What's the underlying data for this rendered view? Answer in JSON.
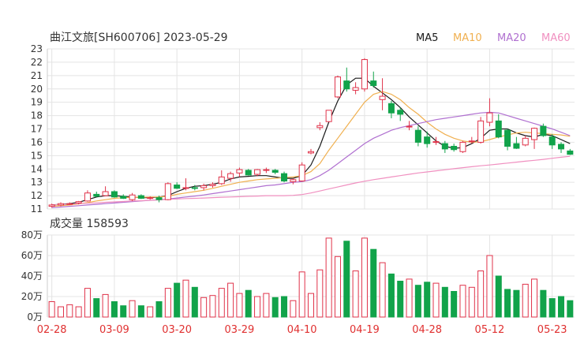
{
  "header": {
    "title": "曲江文旅[SH600706] 2023-05-29",
    "legend": [
      {
        "label": "MA5",
        "color": "#1a1a1a"
      },
      {
        "label": "MA10",
        "color": "#f0b050"
      },
      {
        "label": "MA20",
        "color": "#b070d0"
      },
      {
        "label": "MA60",
        "color": "#f090c0"
      }
    ]
  },
  "volume_panel": {
    "title": "成交量 158593"
  },
  "colors": {
    "up": "#e0334a",
    "down": "#11a34a",
    "grid": "#e4e4e4",
    "text": "#333333",
    "xtick": "#e03030"
  },
  "chart_data": [
    {
      "type": "candlestick",
      "title": "曲江文旅[SH600706] 2023-05-29",
      "ylim": [
        11,
        23
      ],
      "yticks": [
        11,
        12,
        13,
        14,
        15,
        16,
        17,
        18,
        19,
        20,
        21,
        22,
        23
      ],
      "grid": true,
      "legend_position": "top-right",
      "xticks": [
        "02-28",
        "03-09",
        "03-20",
        "03-29",
        "04-10",
        "04-19",
        "04-28",
        "05-12",
        "05-23"
      ],
      "xtick_index": [
        0,
        7,
        14,
        21,
        28,
        35,
        42,
        49,
        56
      ],
      "series": [
        {
          "name": "MA5",
          "values": [
            11.3,
            11.35,
            11.4,
            11.5,
            11.7,
            11.9,
            12.0,
            12.0,
            11.95,
            11.9,
            11.85,
            11.85,
            11.9,
            12.0,
            12.3,
            12.55,
            12.7,
            12.75,
            12.85,
            13.0,
            13.25,
            13.4,
            13.45,
            13.5,
            13.5,
            13.4,
            13.3,
            13.3,
            13.5,
            14.3,
            15.7,
            17.5,
            19.1,
            20.3,
            20.8,
            20.8,
            20.2,
            19.7,
            19.2,
            18.6,
            17.9,
            17.3,
            16.7,
            16.1,
            15.7,
            15.55,
            15.6,
            15.9,
            16.3,
            16.9,
            17.0,
            17.0,
            16.7,
            16.5,
            16.4,
            16.6,
            16.5,
            16.2,
            15.9
          ]
        },
        {
          "name": "MA10",
          "values": [
            11.2,
            11.25,
            11.3,
            11.38,
            11.48,
            11.6,
            11.7,
            11.8,
            11.85,
            11.88,
            11.88,
            11.9,
            11.9,
            11.95,
            12.1,
            12.2,
            12.3,
            12.4,
            12.55,
            12.7,
            12.85,
            13.0,
            13.1,
            13.2,
            13.25,
            13.3,
            13.35,
            13.4,
            13.5,
            13.8,
            14.4,
            15.4,
            16.3,
            17.2,
            18.1,
            19.0,
            19.6,
            19.8,
            19.6,
            19.2,
            18.6,
            18.1,
            17.5,
            17.0,
            16.6,
            16.3,
            16.1,
            16.0,
            16.05,
            16.2,
            16.4,
            16.55,
            16.7,
            16.75,
            16.7,
            16.65,
            16.6,
            16.55,
            16.45
          ]
        },
        {
          "name": "MA20",
          "values": [
            11.1,
            11.15,
            11.2,
            11.25,
            11.3,
            11.35,
            11.4,
            11.45,
            11.5,
            11.55,
            11.6,
            11.65,
            11.7,
            11.75,
            11.82,
            11.9,
            11.97,
            12.05,
            12.15,
            12.25,
            12.35,
            12.45,
            12.55,
            12.65,
            12.75,
            12.8,
            12.9,
            13.0,
            13.05,
            13.2,
            13.5,
            13.9,
            14.4,
            14.9,
            15.4,
            15.9,
            16.3,
            16.6,
            16.9,
            17.1,
            17.25,
            17.4,
            17.55,
            17.7,
            17.8,
            17.9,
            18.0,
            18.1,
            18.2,
            18.25,
            18.2,
            18.0,
            17.8,
            17.6,
            17.4,
            17.2,
            17.0,
            16.75,
            16.5
          ]
        },
        {
          "name": "MA60",
          "values": [
            11.3,
            11.33,
            11.36,
            11.4,
            11.43,
            11.46,
            11.5,
            11.53,
            11.56,
            11.6,
            11.62,
            11.65,
            11.68,
            11.72,
            11.75,
            11.78,
            11.8,
            11.82,
            11.85,
            11.88,
            11.9,
            11.92,
            11.95,
            11.97,
            12.0,
            12.0,
            12.0,
            12.02,
            12.08,
            12.2,
            12.35,
            12.5,
            12.65,
            12.8,
            12.95,
            13.08,
            13.2,
            13.3,
            13.4,
            13.5,
            13.6,
            13.7,
            13.78,
            13.86,
            13.94,
            14.02,
            14.1,
            14.17,
            14.24,
            14.3,
            14.37,
            14.44,
            14.51,
            14.58,
            14.65,
            14.72,
            14.8,
            14.88,
            14.95
          ]
        }
      ],
      "ohlc": [
        [
          11.2,
          11.4,
          11.1,
          11.3
        ],
        [
          11.3,
          11.5,
          11.2,
          11.4
        ],
        [
          11.4,
          11.5,
          11.3,
          11.4
        ],
        [
          11.45,
          11.6,
          11.35,
          11.55
        ],
        [
          11.6,
          12.4,
          11.55,
          12.2
        ],
        [
          12.1,
          12.3,
          11.9,
          11.95
        ],
        [
          12.0,
          12.7,
          11.95,
          12.3
        ],
        [
          12.3,
          12.4,
          11.85,
          11.9
        ],
        [
          11.95,
          12.1,
          11.75,
          11.8
        ],
        [
          11.7,
          12.2,
          11.6,
          12.05
        ],
        [
          12.0,
          12.1,
          11.75,
          11.8
        ],
        [
          11.8,
          11.95,
          11.7,
          11.85
        ],
        [
          11.85,
          12.0,
          11.5,
          11.7
        ],
        [
          11.7,
          13.0,
          11.65,
          12.9
        ],
        [
          12.8,
          13.0,
          12.5,
          12.55
        ],
        [
          12.6,
          13.3,
          12.4,
          12.6
        ],
        [
          12.6,
          12.8,
          12.4,
          12.55
        ],
        [
          12.6,
          12.9,
          12.4,
          12.75
        ],
        [
          12.75,
          13.0,
          12.6,
          12.85
        ],
        [
          12.9,
          13.9,
          12.8,
          13.4
        ],
        [
          13.3,
          13.8,
          13.05,
          13.65
        ],
        [
          13.7,
          14.1,
          13.4,
          13.95
        ],
        [
          13.9,
          14.0,
          13.5,
          13.55
        ],
        [
          13.6,
          14.0,
          13.45,
          13.95
        ],
        [
          13.9,
          14.1,
          13.7,
          13.95
        ],
        [
          13.9,
          14.0,
          13.6,
          13.75
        ],
        [
          13.65,
          13.8,
          13.0,
          13.1
        ],
        [
          13.05,
          13.3,
          12.85,
          13.2
        ],
        [
          13.1,
          14.5,
          13.05,
          14.3
        ],
        [
          15.2,
          15.5,
          15.1,
          15.3
        ],
        [
          17.1,
          17.5,
          16.9,
          17.25
        ],
        [
          17.55,
          18.4,
          17.5,
          18.4
        ],
        [
          19.4,
          21.0,
          19.3,
          20.9
        ],
        [
          20.6,
          21.6,
          19.8,
          20.0
        ],
        [
          19.9,
          20.5,
          19.6,
          20.1
        ],
        [
          20.0,
          22.3,
          19.8,
          22.2
        ],
        [
          20.6,
          21.3,
          20.1,
          20.25
        ],
        [
          19.2,
          20.8,
          18.4,
          19.45
        ],
        [
          18.9,
          19.1,
          17.8,
          18.2
        ],
        [
          18.4,
          18.6,
          17.6,
          18.1
        ],
        [
          17.2,
          17.6,
          16.9,
          17.2
        ],
        [
          16.9,
          17.2,
          15.7,
          16.0
        ],
        [
          16.4,
          16.8,
          15.6,
          15.9
        ],
        [
          16.0,
          16.4,
          15.8,
          16.05
        ],
        [
          15.9,
          16.1,
          15.2,
          15.5
        ],
        [
          15.7,
          15.9,
          15.3,
          15.45
        ],
        [
          15.3,
          16.1,
          15.2,
          16.0
        ],
        [
          16.1,
          16.4,
          15.9,
          16.1
        ],
        [
          16.0,
          17.9,
          15.9,
          17.6
        ],
        [
          17.5,
          19.3,
          17.2,
          18.2
        ],
        [
          17.6,
          18.1,
          16.3,
          16.4
        ],
        [
          16.9,
          17.0,
          15.4,
          15.7
        ],
        [
          15.9,
          16.4,
          15.5,
          15.55
        ],
        [
          15.8,
          16.5,
          15.7,
          16.3
        ],
        [
          16.2,
          17.1,
          15.5,
          17.05
        ],
        [
          17.2,
          17.4,
          16.4,
          16.5
        ],
        [
          16.4,
          16.6,
          15.5,
          15.8
        ],
        [
          15.85,
          16.0,
          15.2,
          15.5
        ],
        [
          15.35,
          15.5,
          15.05,
          15.1
        ]
      ]
    },
    {
      "type": "bar",
      "title": "成交量 158593",
      "ylim": [
        0,
        80
      ],
      "yticks": [
        "0万",
        "20万",
        "40万",
        "60万",
        "80万"
      ],
      "ytick_values": [
        0,
        20,
        40,
        60,
        80
      ],
      "unit": "万",
      "values": [
        15,
        10,
        12,
        10,
        28,
        18,
        22,
        15,
        11,
        16,
        11,
        10,
        15,
        28,
        33,
        36,
        29,
        19,
        21,
        28,
        33,
        23,
        26,
        20,
        23,
        19,
        20,
        16,
        44,
        23,
        46,
        77,
        59,
        74,
        45,
        77,
        66,
        53,
        42,
        35,
        37,
        31,
        34,
        33,
        29,
        25,
        31,
        29,
        45,
        60,
        40,
        27,
        26,
        32,
        37,
        26,
        18,
        20,
        16
      ]
    }
  ]
}
